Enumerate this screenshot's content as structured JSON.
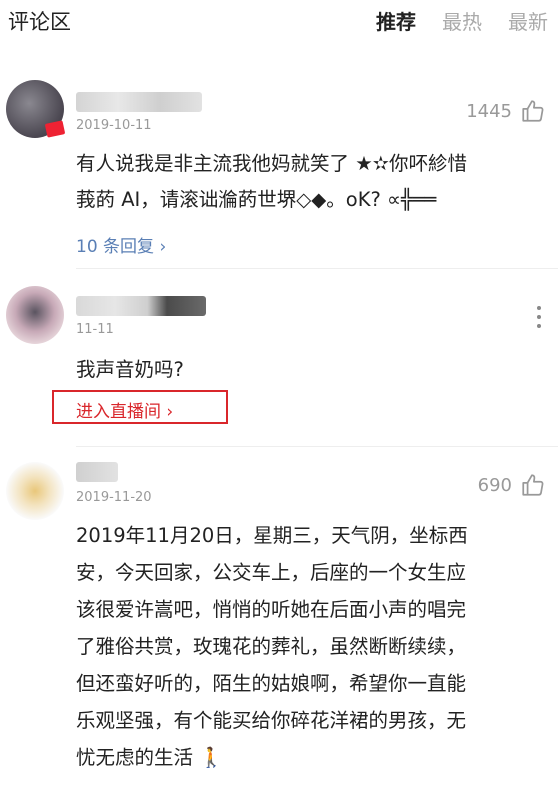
{
  "header": {
    "title": "评论区",
    "tabs": [
      {
        "label": "推荐",
        "active": true
      },
      {
        "label": "最热",
        "active": false
      },
      {
        "label": "最新",
        "active": false
      }
    ]
  },
  "comments": [
    {
      "date": "2019-10-11",
      "likes": "1445",
      "text_lines": [
        "有人说我是非主流我他妈就笑了 ★✫你吥紾惜",
        "莪菂 AI，请滚诎溣菂世堺◇◆。oK? ∝╬══"
      ],
      "replies": "10 条回复"
    },
    {
      "date": "11-11",
      "text_lines": [
        "我声音奶吗?"
      ],
      "link": "进入直播间"
    },
    {
      "date": "2019-11-20",
      "likes": "690",
      "text_lines": [
        "2019年11月20日，星期三，天气阴，坐标西",
        "安，今天回家，公交车上，后座的一个女生应",
        "该很爱许嵩吧，悄悄的听她在后面小声的唱完",
        "了雅俗共赏，玫瑰花的葬礼，虽然断断续续，",
        "但还蛮好听的，陌生的姑娘啊，希望你一直能",
        "乐观坚强，有个能买给你碎花洋裙的男孩，无",
        "忧无虑的生活 🚶"
      ]
    }
  ],
  "colors": {
    "link_red": "#d9262b",
    "reply_blue": "#5a7fb5",
    "meta_gray": "#999999"
  }
}
